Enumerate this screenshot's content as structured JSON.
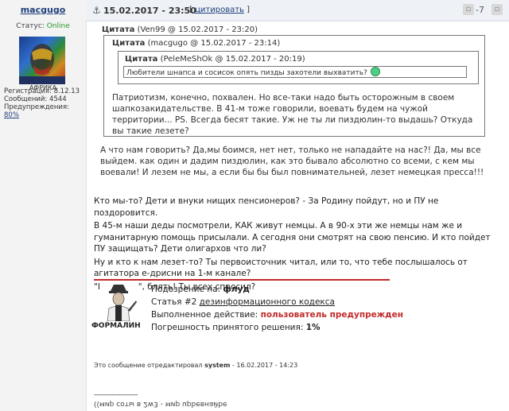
{
  "user": {
    "name": "macgugo",
    "status_label": "Статус:",
    "status_value": "Online",
    "avatar_caption": "АФРИКА",
    "registration": "Регистрация: 8.12.13",
    "messages": "Сообщений: 4544",
    "warnings_label": "Предупреждения:",
    "warnings_value": "80%"
  },
  "header": {
    "date": "15.02.2017 - 23:50",
    "quote_link": "цитировать",
    "rating": "-7"
  },
  "quotes": {
    "q1_author": "(Ven99 @ 15.02.2017 - 23:20)",
    "q2_author": "(macgugo @ 15.02.2017 - 23:14)",
    "q3_author": "(PeleMeShOk @ 15.02.2017 - 20:19)",
    "label": "Цитата",
    "spoiler": "Любители шнапса и сосисок опять пизды захотели выхватить?",
    "q2_text": "Патриотизм, конечно, похвален. Но все-таки надо быть осторожным в своем шапкозакидательстве. В 41-м тоже говорили, воевать будем на чужой территории... PS. Всегда бесят такие. Уж не ты ли пиздюлин-то выдашь? Откуда вы такие лезете?",
    "q1_text": "А что нам говорить? Да,мы боимся, нет нет, только не нападайте на нас?! Да, мы все выйдем. как один и дадим пиздюлин, как это бывало абсолютно со всеми, с кем мы воевали! И лезем не мы, а если бы бы был повнимательней, лезет немецкая пресса!!!"
  },
  "body": {
    "p1": "Кто мы-то? Дети и внуки нищих пенсионеров? - За Родину пойдут, но и ПУ не поздоровится.",
    "p2": "В 45-м наши деды посмотрели, КАК живут немцы. А в 90-х эти же немцы нам же и гуманитарную помощь присылали. А сегодня они смотрят на свою пенсию. И кто пойдет ПУ защищать? Дети олигархов что ли?",
    "p3": "Ну и кто к нам лезет-то? Ты первоисточник читал, или то, что тебе послышалось от агитатора е-дрисни на 1-м канале?",
    "p4": "\"Как один\", блять! Ты всех спросил?"
  },
  "moderation": {
    "name": "ФОРМАЛИН",
    "suspicion_label": "Подозрение на:",
    "suspicion_value": "флуд",
    "article_label": "Статья #2",
    "article_link": "дезинформационного кодекса",
    "action_label": "Выполненное действие:",
    "action_value": "пользователь предупрежден",
    "error_label": "Погрешность принятого решения:",
    "error_value": "1%"
  },
  "edited": {
    "prefix": "Это сообщение отредактировал",
    "editor": "system",
    "suffix": "- 16.02.2017 - 14:23"
  },
  "signature": {
    "line": "--------------------",
    "text": "((мир соты в 2w3 - мир upbeвнайbe"
  }
}
